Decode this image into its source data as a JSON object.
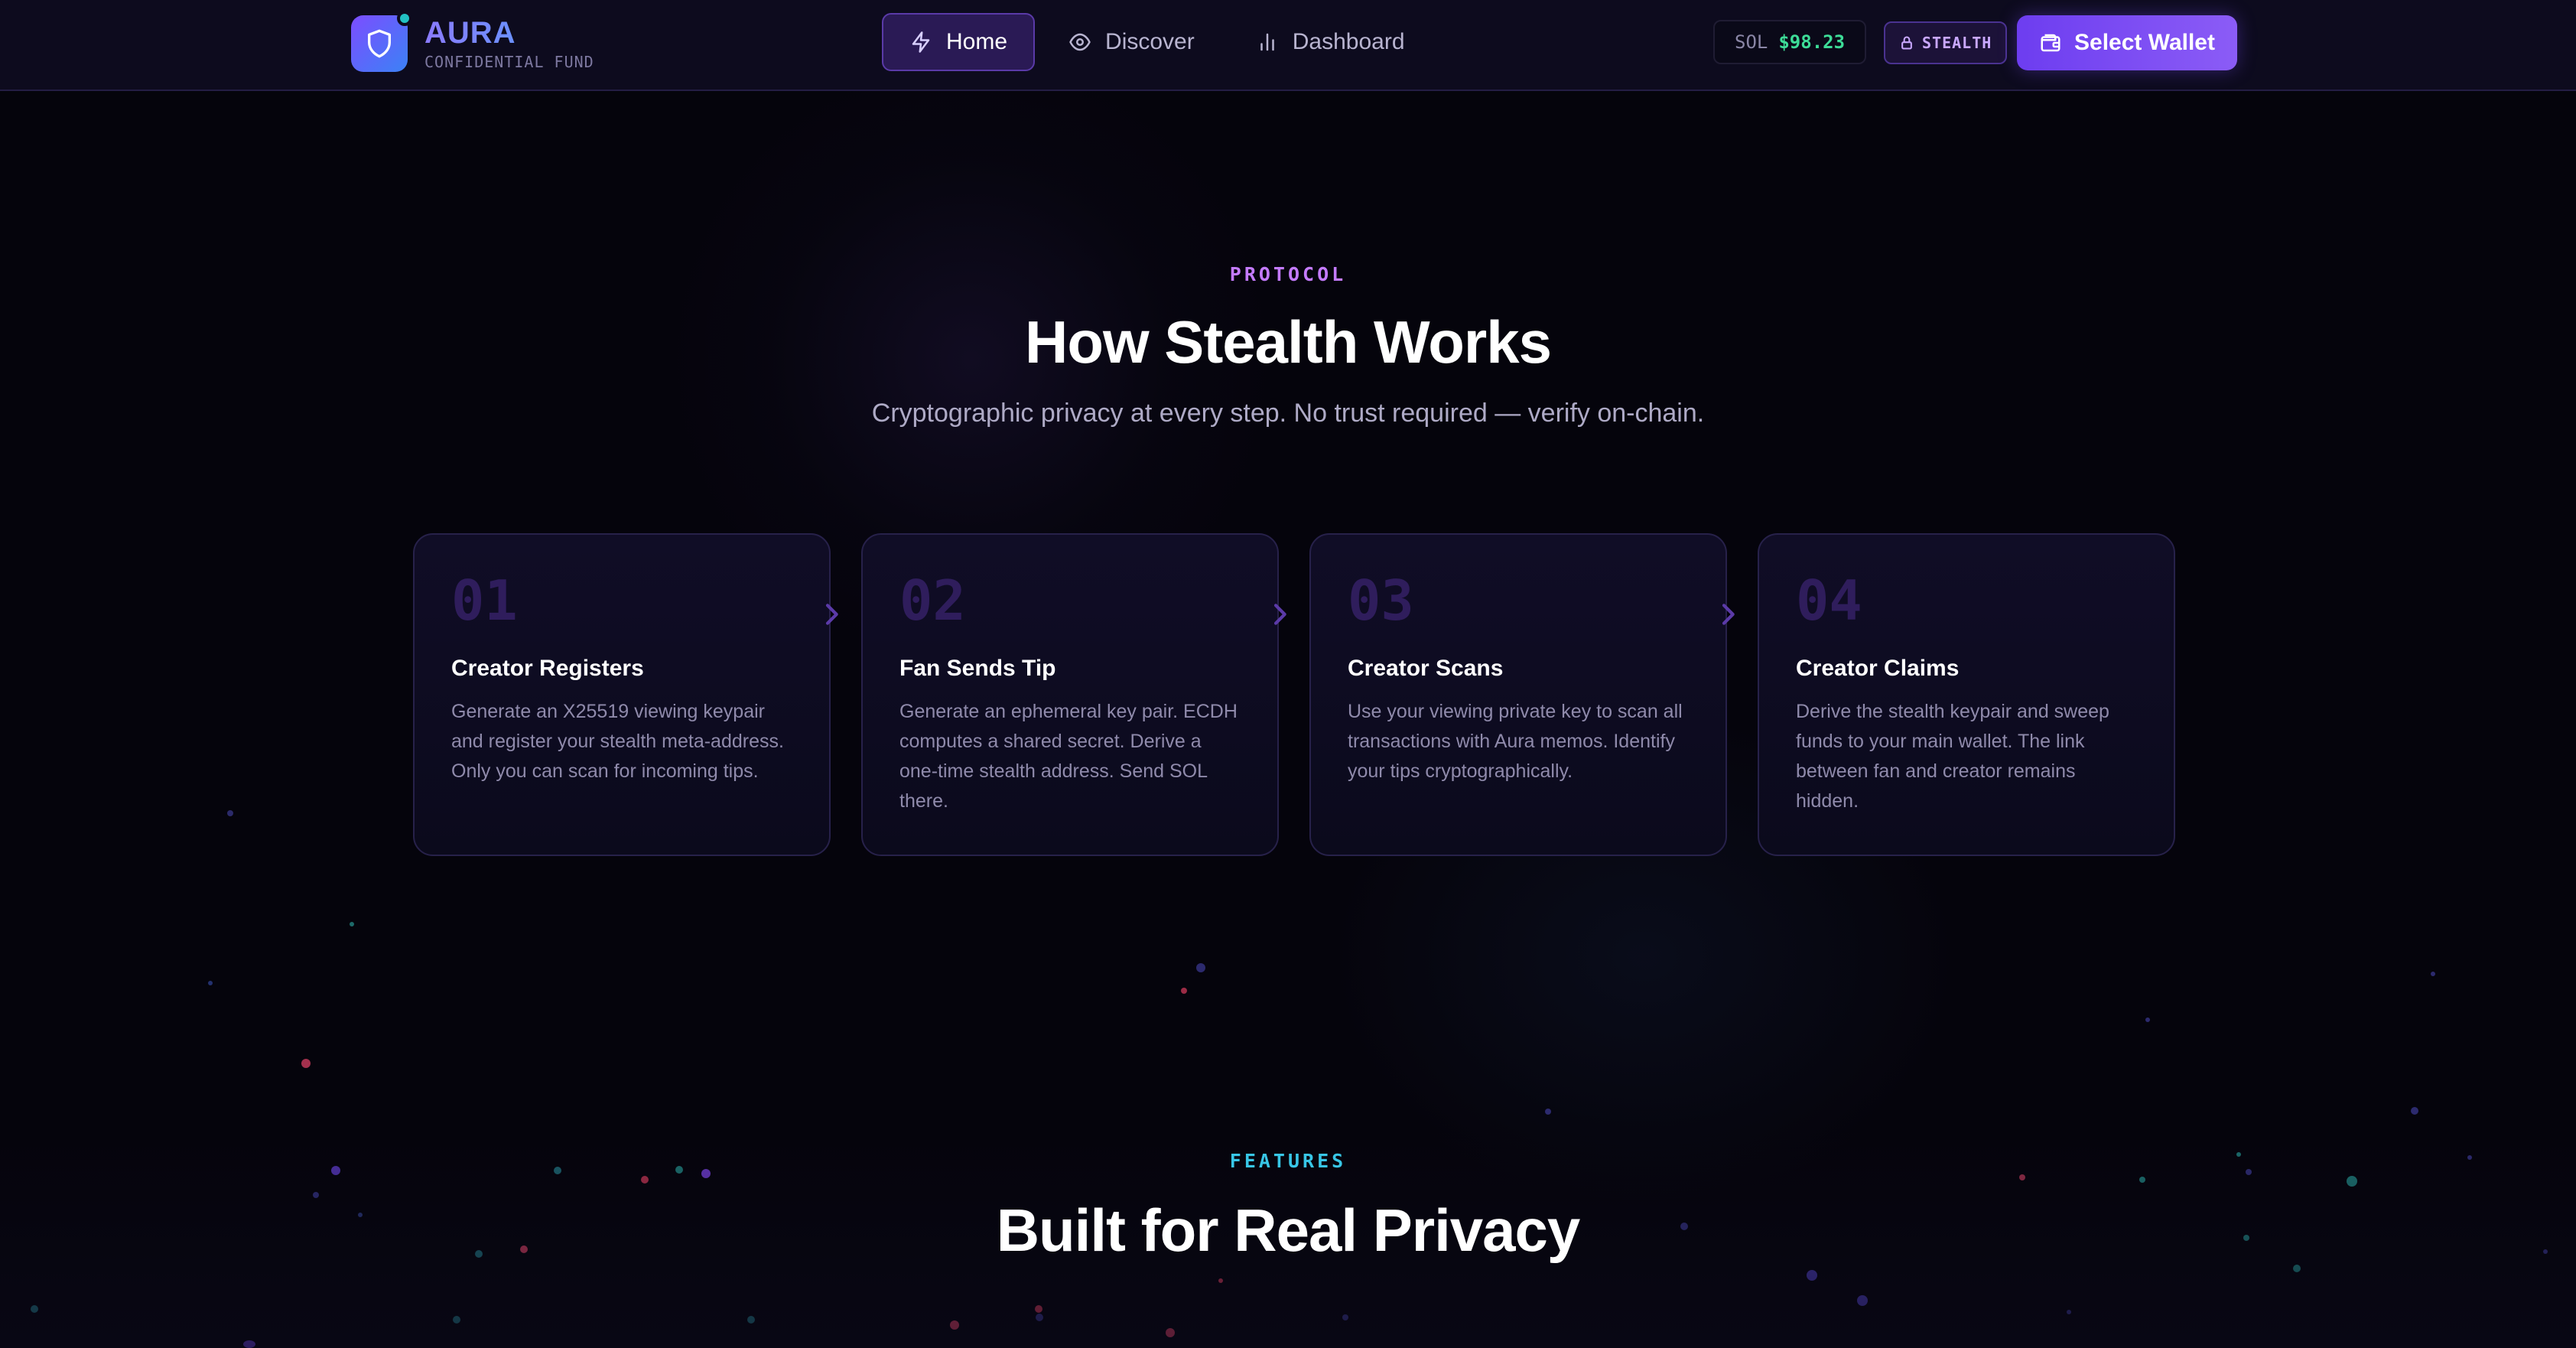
{
  "nav": {
    "brand": {
      "name": "AURA",
      "subtitle": "CONFIDENTIAL FUND"
    },
    "links": [
      {
        "label": "Home",
        "icon": "lightning-icon",
        "active": true
      },
      {
        "label": "Discover",
        "icon": "eye-icon",
        "active": false
      },
      {
        "label": "Dashboard",
        "icon": "bar-chart-icon",
        "active": false
      }
    ],
    "price": {
      "label": "SOL",
      "value": "$98.23"
    },
    "badge": {
      "label": "STEALTH",
      "icon": "lock-icon"
    },
    "wallet_button": {
      "label": "Select Wallet",
      "icon": "wallet-icon"
    }
  },
  "protocol": {
    "eyebrow": "PROTOCOL",
    "title": "How Stealth Works",
    "subtitle": "Cryptographic privacy at every step. No trust required — verify on-chain.",
    "steps": [
      {
        "number": "01",
        "title": "Creator Registers",
        "description": "Generate an X25519 viewing keypair and register your stealth meta-address. Only you can scan for incoming tips."
      },
      {
        "number": "02",
        "title": "Fan Sends Tip",
        "description": "Generate an ephemeral key pair. ECDH computes a shared secret. Derive a one-time stealth address. Send SOL there."
      },
      {
        "number": "03",
        "title": "Creator Scans",
        "description": "Use your viewing private key to scan all transactions with Aura memos. Identify your tips cryptographically."
      },
      {
        "number": "04",
        "title": "Creator Claims",
        "description": "Derive the stealth keypair and sweep funds to your main wallet. The link between fan and creator remains hidden."
      }
    ]
  },
  "features": {
    "eyebrow": "FEATURES",
    "title": "Built for Real Privacy"
  },
  "colors": {
    "accent_purple": "#7c4dff",
    "protocol_eyebrow": "#c47bff",
    "features_eyebrow": "#38c6e6",
    "price_green": "#3ddc97",
    "background": "#05040c"
  }
}
